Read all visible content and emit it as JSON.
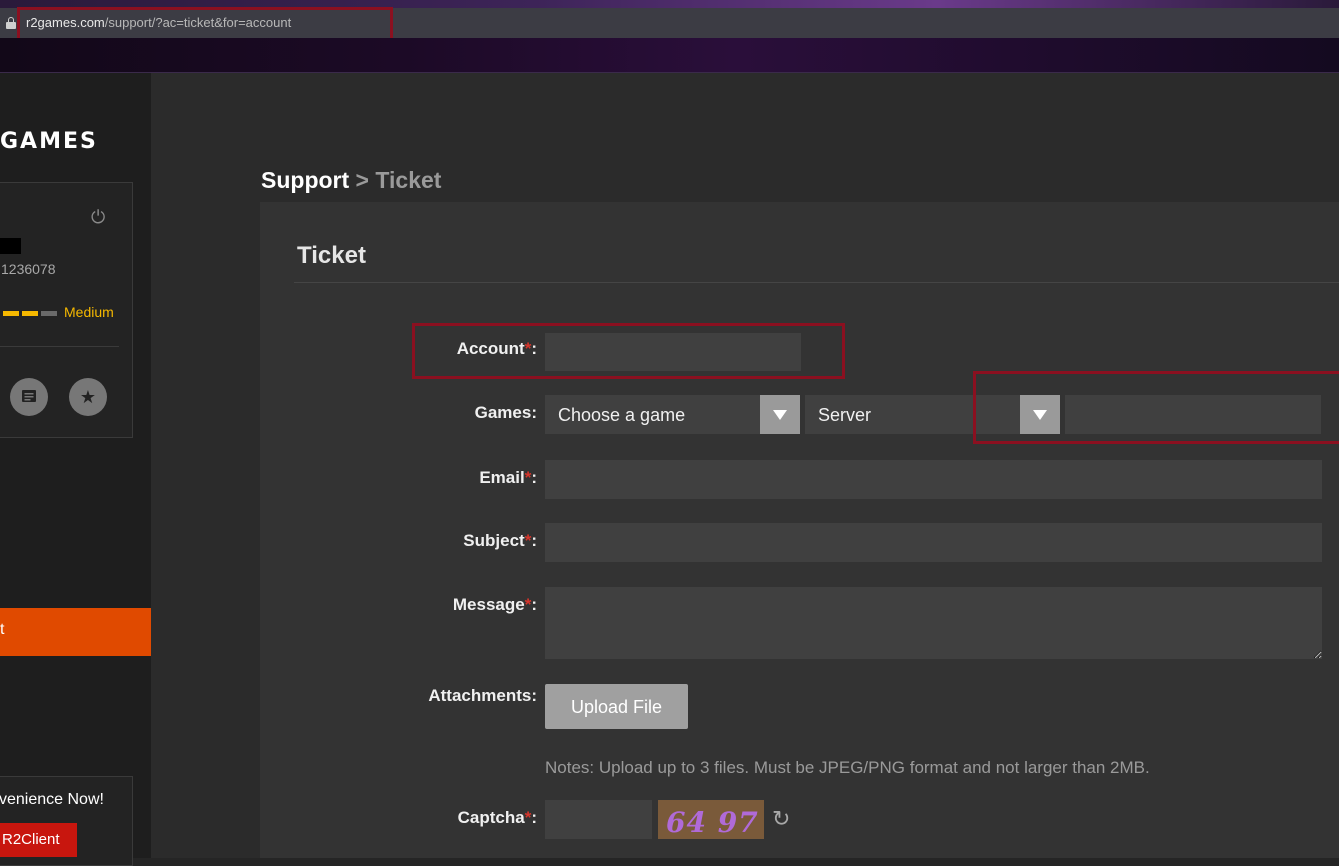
{
  "browser": {
    "url_host": "r2games.com",
    "url_path": "/support/?ac=ticket&for=account"
  },
  "sidebar": {
    "logo": "GAMES",
    "user_id": "1236078",
    "strength_label": "Medium",
    "active_item": "t",
    "promo_text": "venience Now!",
    "promo_button": "R2Client"
  },
  "breadcrumb": {
    "root": "Support",
    "separator": ">",
    "current": "Ticket"
  },
  "form": {
    "title": "Ticket",
    "account_label": "Account",
    "games_label": "Games",
    "email_label": "Email",
    "subject_label": "Subject",
    "message_label": "Message",
    "attachments_label": "Attachments",
    "captcha_label": "Captcha",
    "required_mark": "*",
    "colon": ":",
    "game_select": "Choose a game",
    "server_select": "Server",
    "upload_button": "Upload File",
    "notes": "Notes: Upload up to 3 files. Must be JPEG/PNG format and not larger than 2MB.",
    "captcha_text": "64 97"
  },
  "colors": {
    "accent_orange": "#e04a00",
    "required": "#d9352b",
    "highlight": "#8b1020",
    "strength": "#f5b800"
  }
}
